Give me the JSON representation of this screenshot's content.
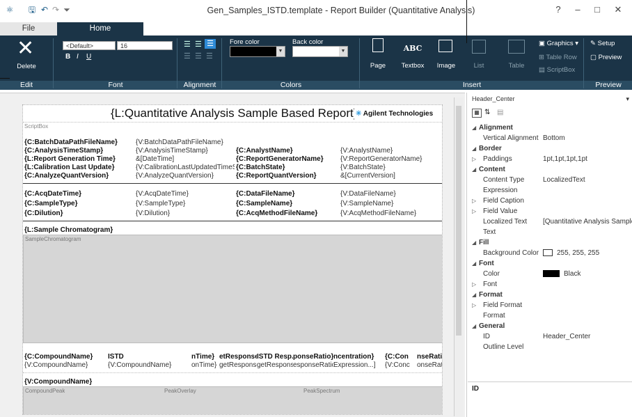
{
  "window": {
    "title": "Gen_Samples_ISTD.template - Report Builder (Quantitative Analysis)",
    "help": "?",
    "minimize": "–",
    "maximize": "□",
    "close": "✕"
  },
  "tabs": {
    "file": "File",
    "home": "Home"
  },
  "ribbon": {
    "delete_label": "Delete",
    "font_name": "<Default>",
    "font_size": "16",
    "bold": "B",
    "italic": "I",
    "underline": "U",
    "fore_color": "Fore color",
    "back_color": "Back color",
    "page": "Page",
    "textbox": "Textbox",
    "textbox_icon": "ABC",
    "image": "Image",
    "list": "List",
    "table": "Table",
    "graphics": "Graphics",
    "table_row": "Table Row",
    "scriptbox": "ScriptBox",
    "setup": "Setup",
    "preview": "Preview",
    "groups": [
      "Edit",
      "Font",
      "Alignment",
      "Colors",
      "Insert",
      "Preview"
    ]
  },
  "report": {
    "header_title": "{L:Quantitative Analysis Sample Based Report}",
    "brand": "Agilent Technologies",
    "scriptbox": "ScriptBox",
    "rows1": [
      [
        "{C:BatchDataPathFileName}",
        "{V:BatchDataPathFileName}",
        "",
        ""
      ],
      [
        "{C:AnalysisTimeStamp}",
        "{V:AnalysisTimeStamp}",
        "{C:AnalystName}",
        "{V:AnalystName}"
      ],
      [
        "{L:Report Generation Time}",
        "&[DateTime]",
        "{C:ReportGeneratorName}",
        "{V:ReportGeneratorName}"
      ],
      [
        "{L:Calibration Last Update}",
        "{V:CalibrationLastUpdatedTimeStar",
        "{C:BatchState}",
        "{V:BatchState}"
      ],
      [
        "{C:AnalyzeQuantVersion}",
        "{V:AnalyzeQuantVersion}",
        "{C:ReportQuantVersion}",
        "&[CurrentVersion]"
      ]
    ],
    "rows2": [
      [
        "{C:AcqDateTime}",
        "{V:AcqDateTime}",
        "{C:DataFileName}",
        "{V:DataFileName}"
      ],
      [
        "{C:SampleType}",
        "{V:SampleType}",
        "{C:SampleName}",
        "{V:SampleName}"
      ],
      [
        "{C:Dilution}",
        "{V:Dilution}",
        "{C:AcqMethodFileName}",
        "{V:AcqMethodFileName}"
      ]
    ],
    "chrom_title": "{L:Sample Chromatogram}",
    "chrom_box": "SampleChromatogram",
    "table_head": [
      "{C:CompoundName}",
      "ISTD",
      "nTime}",
      "etResponse}",
      "ISTD Resp.",
      "ponseRatio}",
      "ncentration}",
      "{C:Con",
      "nseRatio}"
    ],
    "table_vals": [
      "{V:CompoundName}",
      "{V:CompoundName}",
      "onTime}",
      "getResponse}",
      "getResponse}",
      "esponseRatio}",
      "Expression...]",
      "{V:Conc",
      "onseRatio}"
    ],
    "compound": "{V:CompoundName}",
    "peak_boxes": [
      "CompoundPeak",
      "PeakOverlay",
      "PeakSpectrum"
    ]
  },
  "props": {
    "selected": "Header_Center",
    "rows": [
      {
        "type": "cat",
        "arrow": "◢",
        "key": "Alignment",
        "val": ""
      },
      {
        "type": "item",
        "key": "Vertical Alignment",
        "val": "Bottom"
      },
      {
        "type": "cat",
        "arrow": "◢",
        "key": "Border",
        "val": ""
      },
      {
        "type": "sub",
        "arrow": "▷",
        "key": "Paddings",
        "val": "1pt,1pt,1pt,1pt"
      },
      {
        "type": "cat",
        "arrow": "◢",
        "key": "Content",
        "val": ""
      },
      {
        "type": "item",
        "key": "Content Type",
        "val": "LocalizedText"
      },
      {
        "type": "item",
        "key": "Expression",
        "val": ""
      },
      {
        "type": "sub",
        "arrow": "▷",
        "key": "Field Caption",
        "val": ""
      },
      {
        "type": "sub",
        "arrow": "▷",
        "key": "Field Value",
        "val": ""
      },
      {
        "type": "item",
        "key": "Localized Text",
        "val": "[Quantitative Analysis Sample B"
      },
      {
        "type": "item",
        "key": "Text",
        "val": ""
      },
      {
        "type": "cat",
        "arrow": "◢",
        "key": "Fill",
        "val": ""
      },
      {
        "type": "item",
        "key": "Background Color",
        "val": "255, 255, 255"
      },
      {
        "type": "cat",
        "arrow": "◢",
        "key": "Font",
        "val": ""
      },
      {
        "type": "item",
        "key": "Color",
        "val": "Black"
      },
      {
        "type": "sub",
        "arrow": "▷",
        "key": "Font",
        "val": ""
      },
      {
        "type": "cat",
        "arrow": "◢",
        "key": "Format",
        "val": ""
      },
      {
        "type": "sub",
        "arrow": "▷",
        "key": "Field Format",
        "val": ""
      },
      {
        "type": "item",
        "key": "Format",
        "val": ""
      },
      {
        "type": "cat",
        "arrow": "◢",
        "key": "General",
        "val": ""
      },
      {
        "type": "item",
        "key": "ID",
        "val": "Header_Center"
      },
      {
        "type": "item",
        "key": "Outline Level",
        "val": ""
      }
    ],
    "desc_title": "ID"
  }
}
